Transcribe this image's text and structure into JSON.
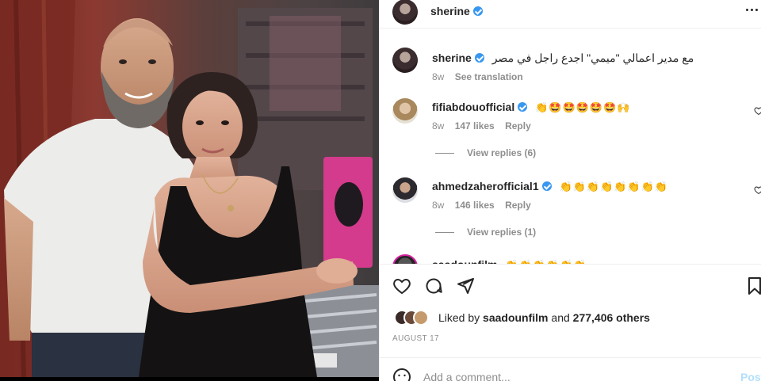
{
  "post": {
    "author": "sherine",
    "more_icon": "more-horizontal-icon"
  },
  "caption": {
    "username": "sherine",
    "text": "مع مدير اعمالي \"ميمي\" اجدع راجل في مصر",
    "age": "8w",
    "see_translation": "See translation"
  },
  "comments": [
    {
      "username": "fifiabdouofficial",
      "emojis": "👏🤩🤩🤩🤩🤩🙌",
      "age": "8w",
      "likes": "147 likes",
      "reply": "Reply",
      "view_replies": "View replies (6)"
    },
    {
      "username": "ahmedzaherofficial1",
      "emojis": "👏👏👏👏👏👏👏👏",
      "age": "8w",
      "likes": "146 likes",
      "reply": "Reply",
      "view_replies": "View replies (1)"
    }
  ],
  "partial_comment": {
    "username": "saadounfilm",
    "emojis": "👏👏👏👏👏👏"
  },
  "actions": {
    "like_icon": "heart-icon",
    "comment_icon": "comment-icon",
    "share_icon": "share-icon",
    "save_icon": "bookmark-icon"
  },
  "likes": {
    "prefix": "Liked by",
    "user": "saadounfilm",
    "middle": "and",
    "count": "277,406 others"
  },
  "date": "AUGUST 17",
  "add_comment": {
    "placeholder": "Add a comment...",
    "post_label": "Post"
  },
  "colors": {
    "verified": "#3897f0",
    "secondary_text": "#8e8e8e",
    "post_button": "#b2dffc"
  }
}
